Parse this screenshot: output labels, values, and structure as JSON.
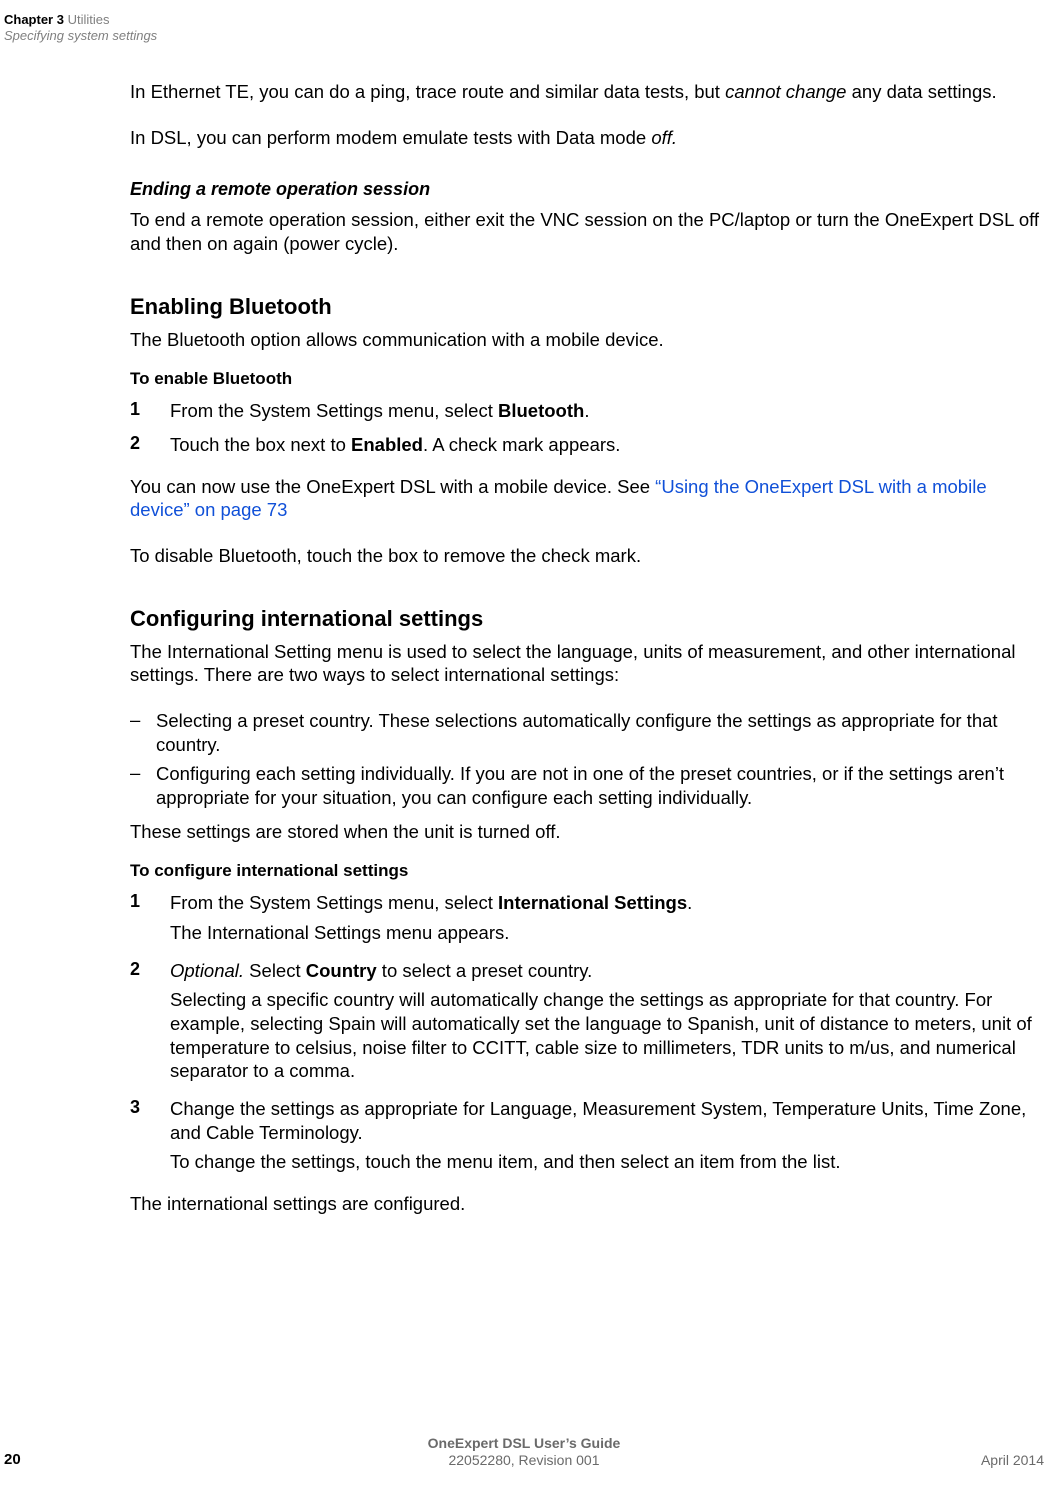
{
  "header": {
    "chapter_bold": "Chapter 3",
    "chapter_gray": " Utilities",
    "section": "Specifying system settings"
  },
  "p1_a": "In Ethernet TE, you can do a ping, trace route and similar data tests, but ",
  "p1_i": "cannot change",
  "p1_b": " any data settings.",
  "p2_a": "In DSL, you can perform modem emulate tests with Data mode ",
  "p2_i": "off.",
  "h3_1": "Ending a remote operation session",
  "p3": "To end a remote operation session, either exit the VNC session on the PC/laptop or turn the OneExpert DSL off and then on again (power cycle).",
  "h2_1": "Enabling Bluetooth",
  "p4": "The Bluetooth option allows communication with a mobile device.",
  "h4_1": "To enable Bluetooth",
  "bt_1_num": "1",
  "bt_1_a": "From the System Settings menu, select ",
  "bt_1_b": "Bluetooth",
  "bt_1_c": ".",
  "bt_2_num": "2",
  "bt_2_a": "Touch the box next to ",
  "bt_2_b": "Enabled",
  "bt_2_c": ". A check mark appears.",
  "p5_a": "You can now use the OneExpert DSL with a mobile device. See ",
  "p5_link": "“Using the OneExpert DSL with a mobile device” on page 73",
  "p6": "To disable Bluetooth, touch the box to remove the check mark.",
  "h2_2": "Configuring international settings",
  "p7": "The International Setting menu is used to select the language, units of measurement, and other international settings. There are two ways to select international settings:",
  "dash1": "Selecting a preset country. These selections automatically configure the settings as appropriate for that country.",
  "dash2": "Configuring each setting individually. If you are not in one of the preset countries, or if the settings aren’t appropriate for your situation, you can configure each setting individually.",
  "p8": "These settings are stored when the unit is turned off.",
  "h4_2": "To configure international settings",
  "is_1_num": "1",
  "is_1_a": "From the System Settings menu, select ",
  "is_1_b": "International Settings",
  "is_1_c": ".",
  "is_1_d": "The International Settings menu appears.",
  "is_2_num": "2",
  "is_2_i": "Optional.",
  "is_2_a": " Select ",
  "is_2_b": "Country",
  "is_2_c": " to select a preset country.",
  "is_2_d": "Selecting a specific country will automatically change the settings as appropriate for that country. For example, selecting Spain will automatically set the language to Spanish, unit of distance to meters, unit of temperature to celsius, noise filter to CCITT, cable size to millimeters, TDR units to m/us, and numerical separator to a comma.",
  "is_3_num": "3",
  "is_3_a": "Change the settings as appropriate for Language, Measurement System, Temperature Units, Time Zone, and Cable Terminology.",
  "is_3_b": "To change the settings, touch the menu item, and then select an item from the list.",
  "p9": "The international settings are configured.",
  "footer": {
    "title": "OneExpert DSL User’s Guide",
    "sub": "22052280, Revision 001",
    "page": "20",
    "date": "April 2014"
  }
}
